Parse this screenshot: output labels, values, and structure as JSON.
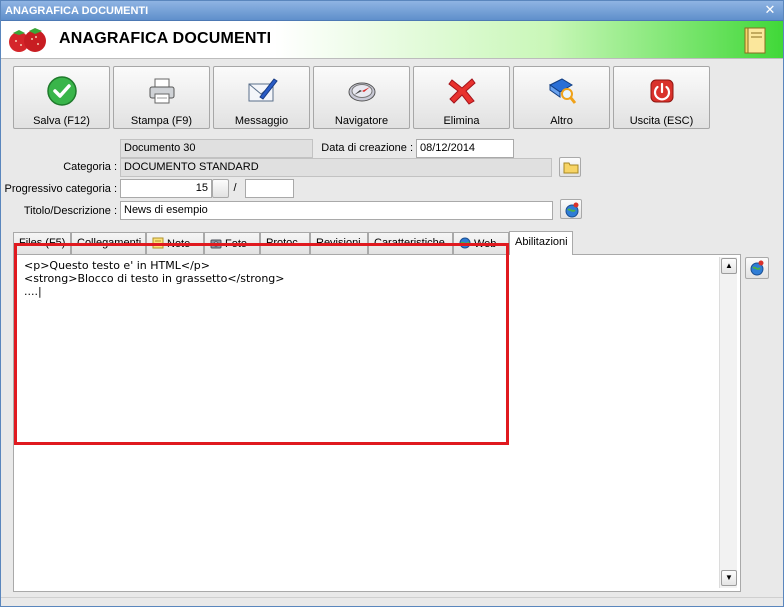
{
  "window": {
    "title": "ANAGRAFICA DOCUMENTI",
    "close_glyph": "✕"
  },
  "header": {
    "title": "ANAGRAFICA DOCUMENTI",
    "logo_icon": "strawberry-icon",
    "right_icon": "book-icon"
  },
  "toolbar": {
    "save": "Salva (F12)",
    "print": "Stampa (F9)",
    "message": "Messaggio",
    "navigator": "Navigatore",
    "delete": "Elimina",
    "other": "Altro",
    "exit": "Uscita (ESC)"
  },
  "form": {
    "document_name": "Documento 30",
    "creation_date_label": "Data di creazione :",
    "creation_date": "08/12/2014",
    "category_label": "Categoria :",
    "category": "DOCUMENTO STANDARD",
    "progressive_label": "Progressivo categoria :",
    "progressive_value": "15",
    "progressive_separator": "/",
    "progressive_suffix": "",
    "title_label": "Titolo/Descrizione :",
    "title_value": "News di esempio"
  },
  "tabs": [
    {
      "label": "Files (F5)"
    },
    {
      "label": "Collegamenti"
    },
    {
      "label": "Note"
    },
    {
      "label": "Foto"
    },
    {
      "label": "Protoc."
    },
    {
      "label": "Revisioni"
    },
    {
      "label": "Caratteristiche"
    },
    {
      "label": "Web"
    },
    {
      "label": "Abilitazioni"
    }
  ],
  "editor": {
    "line1": "<p>Questo testo e' in HTML</p>",
    "line2": "<strong>Blocco di testo in grassetto</strong>",
    "line3": "....|"
  },
  "colors": {
    "highlight": "#e0191f",
    "title_bar": "#6f9bd4",
    "header_green": "#40d838"
  }
}
